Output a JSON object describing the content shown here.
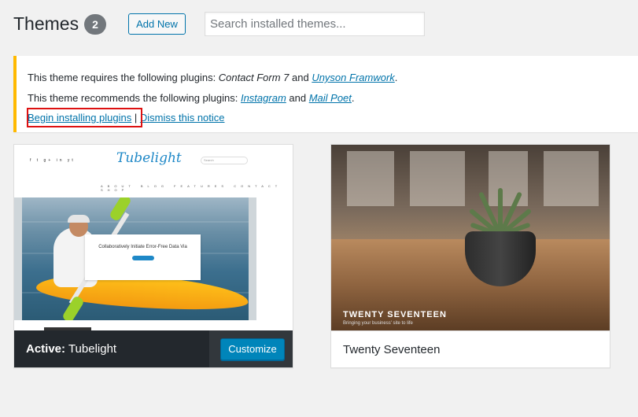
{
  "header": {
    "title": "Themes",
    "count": "2",
    "add_new_label": "Add New",
    "search_placeholder": "Search installed themes..."
  },
  "notice": {
    "requires_prefix": "This theme requires the following plugins: ",
    "required_plugin_1": "Contact Form 7",
    "and_1": " and ",
    "required_plugin_2": "Unyson Framwork",
    "period_1": ".",
    "recommends_prefix": "This theme recommends the following plugins: ",
    "recommended_plugin_1": "Instagram",
    "and_2": " and ",
    "recommended_plugin_2": "Mail Poet",
    "period_2": ".",
    "begin_installing": "Begin installing plugins",
    "separator": " | ",
    "dismiss": "Dismiss this notice"
  },
  "themes": [
    {
      "name": "Tubelight",
      "active_prefix": "Active:",
      "customize_label": "Customize",
      "screenshot": {
        "logo": "Tubelight",
        "social": "f t g+ in yt",
        "search_placeholder": "Search",
        "menu": "ABOUT BLOG FEATURES CONTACT SHOP",
        "headline": "Collaboratively Initiate Error-Free Data Via"
      }
    },
    {
      "name": "Twenty Seventeen",
      "screenshot": {
        "title": "TWENTY SEVENTEEN",
        "tagline": "Bringing your business' site to life"
      }
    }
  ],
  "colors": {
    "accent": "#0073aa",
    "notice_border": "#ffb900",
    "primary_button": "#0085ba",
    "highlight_box": "#dd1111"
  }
}
